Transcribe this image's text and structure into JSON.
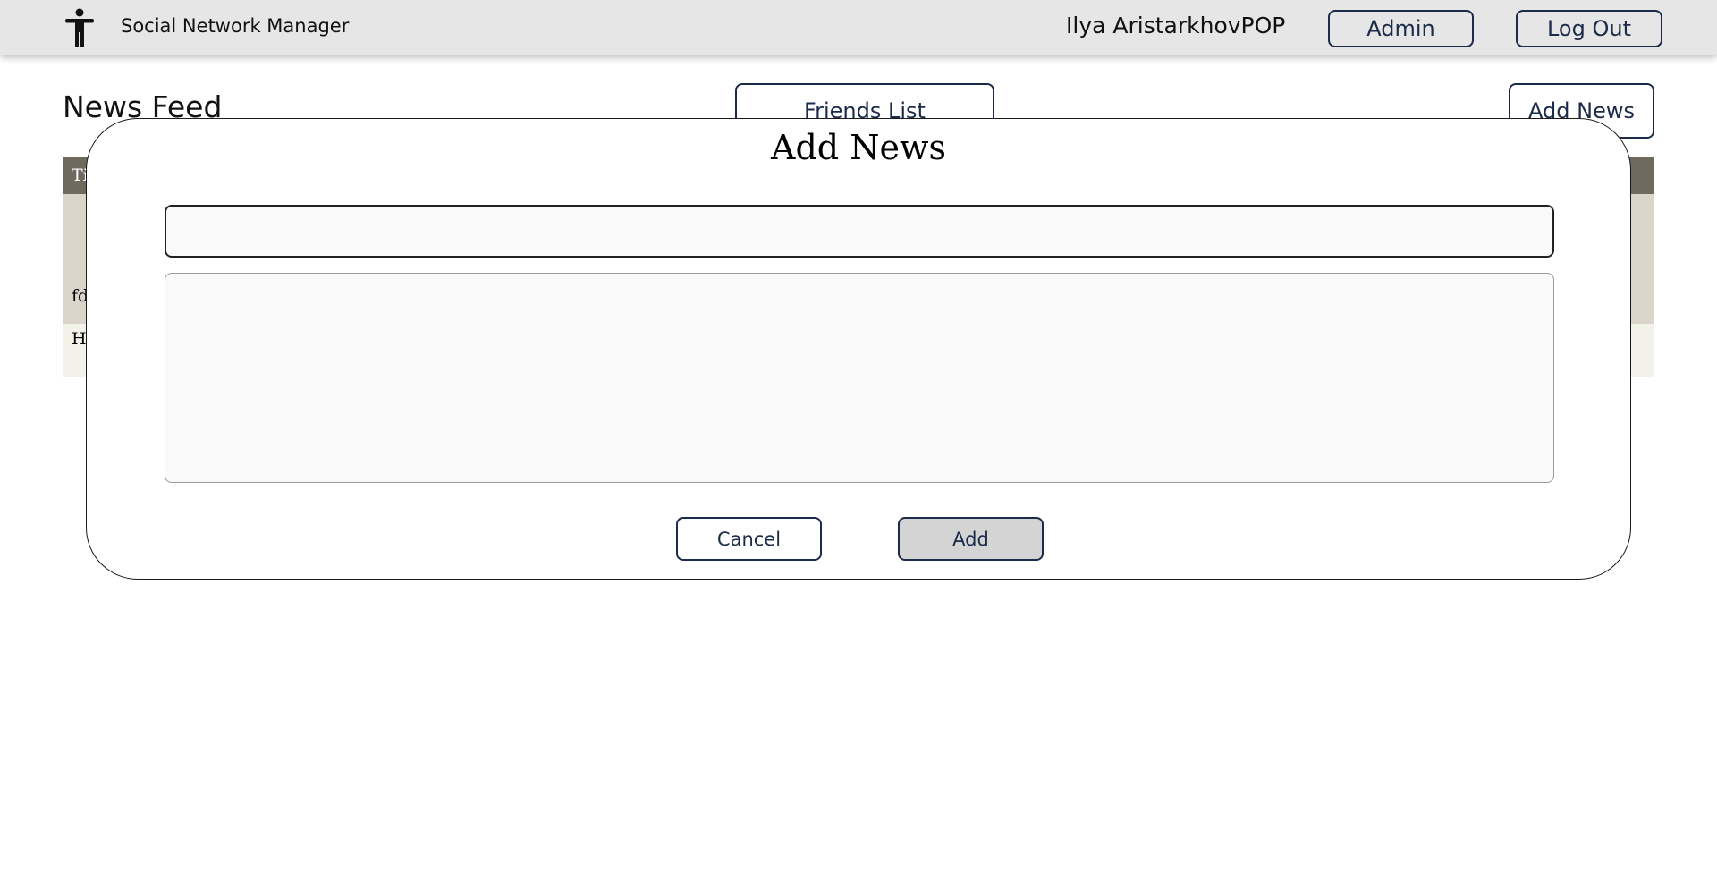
{
  "header": {
    "app_name": "Social Network Manager",
    "logo_icon": "accessibility-person-icon",
    "user_name": "Ilya AristarkhovPOP",
    "admin_label": "Admin",
    "logout_label": "Log Out"
  },
  "page": {
    "title": "News Feed",
    "friends_list_label": "Friends List",
    "add_news_label": "Add News"
  },
  "table": {
    "header_visible": "Ti",
    "rows": [
      {
        "visible_text": "fd"
      },
      {
        "visible_text": "H"
      }
    ]
  },
  "modal": {
    "title": "Add News",
    "title_input": {
      "value": "",
      "placeholder": ""
    },
    "body_input": {
      "value": "",
      "placeholder": ""
    },
    "cancel_label": "Cancel",
    "add_label": "Add"
  },
  "colors": {
    "accent_navy": "#1c2b4a",
    "topbar_bg": "#e6e6e6",
    "table_header_bg": "#6f6a5f",
    "row_a_bg": "#d9d5cb",
    "row_b_bg": "#f3f2e9",
    "add_button_bg": "#d4d4d4"
  }
}
